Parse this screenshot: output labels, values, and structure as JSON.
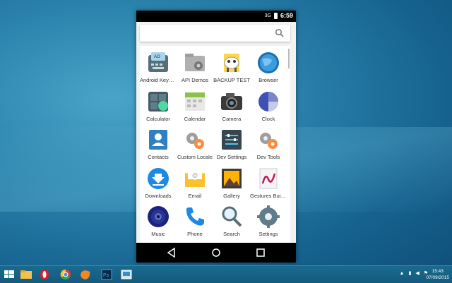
{
  "emulator": {
    "status": {
      "time": "6:59",
      "signal": "3G"
    },
    "apps": [
      {
        "label": "Android Keybo...",
        "icon": "android-keyboard-icon"
      },
      {
        "label": "API Demos",
        "icon": "api-demos-icon"
      },
      {
        "label": "BACKUP TEST",
        "icon": "backup-test-icon"
      },
      {
        "label": "Browser",
        "icon": "browser-icon"
      },
      {
        "label": "Calculator",
        "icon": "calculator-icon"
      },
      {
        "label": "Calendar",
        "icon": "calendar-icon"
      },
      {
        "label": "Camera",
        "icon": "camera-icon"
      },
      {
        "label": "Clock",
        "icon": "clock-icon"
      },
      {
        "label": "Contacts",
        "icon": "contacts-icon"
      },
      {
        "label": "Custom Locale",
        "icon": "custom-locale-icon"
      },
      {
        "label": "Dev Settings",
        "icon": "dev-settings-icon"
      },
      {
        "label": "Dev Tools",
        "icon": "dev-tools-icon"
      },
      {
        "label": "Downloads",
        "icon": "downloads-icon"
      },
      {
        "label": "Email",
        "icon": "email-icon"
      },
      {
        "label": "Gallery",
        "icon": "gallery-icon"
      },
      {
        "label": "Gestures Build...",
        "icon": "gestures-builder-icon"
      },
      {
        "label": "Music",
        "icon": "music-icon"
      },
      {
        "label": "Phone",
        "icon": "phone-icon"
      },
      {
        "label": "Search",
        "icon": "search-app-icon"
      },
      {
        "label": "Settings",
        "icon": "settings-icon"
      }
    ]
  },
  "taskbar": {
    "time": "15:43",
    "date": "07/09/2015",
    "items": [
      "start-icon",
      "file-explorer-icon",
      "opera-icon",
      "chrome-icon",
      "firefox-icon",
      "photoshop-icon",
      "emulator-window-icon"
    ]
  }
}
